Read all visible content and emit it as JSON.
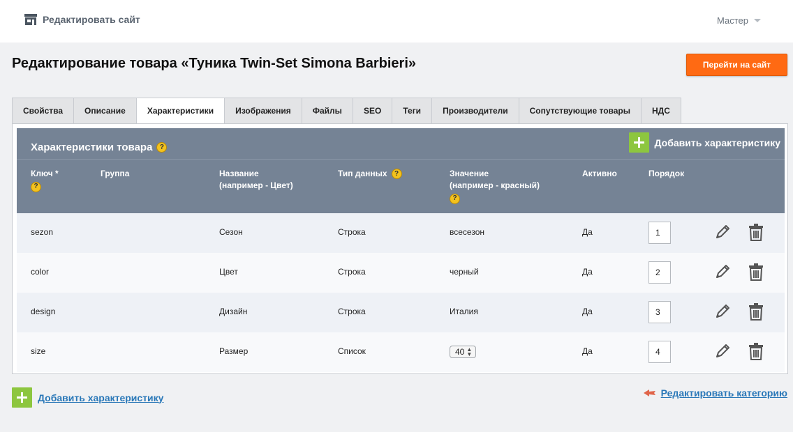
{
  "topbar": {
    "site_label": "Редактировать сайт",
    "user": "Мастер"
  },
  "page": {
    "title": "Редактирование товара «Туника Twin-Set Simona Barbieri»",
    "goto_button": "Перейти на сайт"
  },
  "tabs": [
    {
      "label": "Свойства"
    },
    {
      "label": "Описание"
    },
    {
      "label": "Характеристики",
      "active": true
    },
    {
      "label": "Изображения"
    },
    {
      "label": "Файлы"
    },
    {
      "label": "SEO"
    },
    {
      "label": "Теги"
    },
    {
      "label": "Производители"
    },
    {
      "label": "Сопутствующие товары"
    },
    {
      "label": "НДС"
    }
  ],
  "panel": {
    "title": "Характеристики товара",
    "help": "?",
    "add_label": "Добавить характеристику",
    "columns": {
      "key_line1": "Ключ *",
      "group": "Группа",
      "name_line1": "Название",
      "name_line2": "(например - Цвет)",
      "type": "Тип данных",
      "value_line1": "Значение",
      "value_line2": "(например - красный)",
      "active": "Активно",
      "order": "Порядок"
    },
    "rows": [
      {
        "key": "sezon",
        "name": "Сезон",
        "type": "Строка",
        "value": "всесезон",
        "active": "Да",
        "order": "1"
      },
      {
        "key": "color",
        "name": "Цвет",
        "type": "Строка",
        "value": "черный",
        "active": "Да",
        "order": "2"
      },
      {
        "key": "design",
        "name": "Дизайн",
        "type": "Строка",
        "value": "Италия",
        "active": "Да",
        "order": "3"
      },
      {
        "key": "size",
        "name": "Размер",
        "type": "Список",
        "value": "40",
        "active": "Да",
        "order": "4"
      }
    ]
  },
  "footer": {
    "add_label": "Добавить характеристику",
    "edit_category": "Редактировать категорию"
  },
  "colors": {
    "accent": "#ff6a13",
    "header": "#758395",
    "add_green": "#8dc63f",
    "link": "#2a78b8"
  }
}
